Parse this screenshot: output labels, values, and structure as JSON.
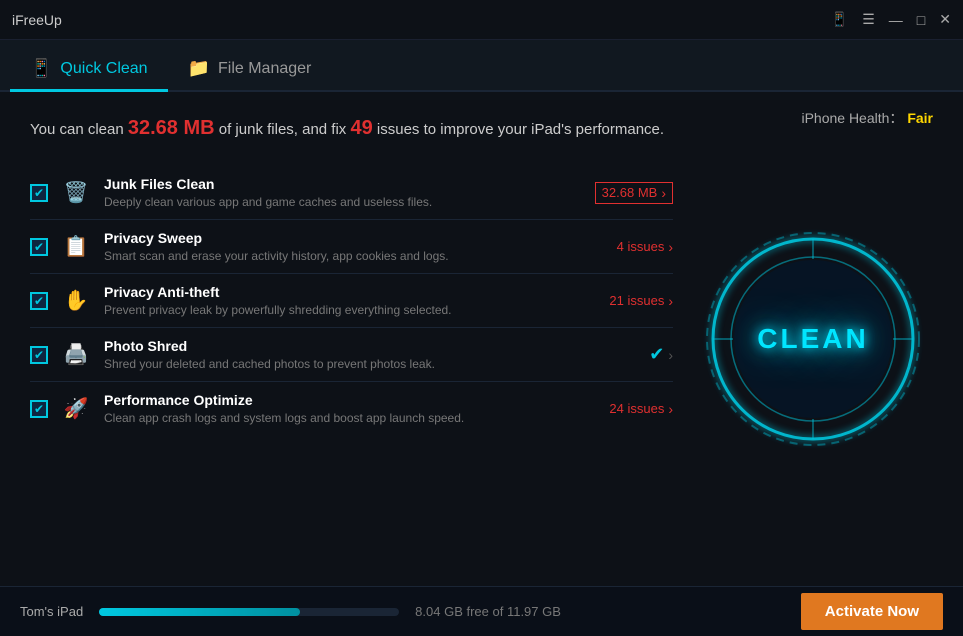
{
  "app": {
    "title": "iFreeUp"
  },
  "window_controls": {
    "device_icon": "📱",
    "menu_icon": "☰",
    "minimize": "—",
    "maximize": "□",
    "close": "✕"
  },
  "tabs": [
    {
      "id": "quick-clean",
      "label": "Quick Clean",
      "icon": "📱",
      "active": true
    },
    {
      "id": "file-manager",
      "label": "File Manager",
      "icon": "📁",
      "active": false
    }
  ],
  "header": {
    "intro_before": "You can clean ",
    "junk_size": "32.68 MB",
    "intro_mid": " of junk files, and fix ",
    "issues_count": "49",
    "intro_after": " issues to improve your iPad's performance.",
    "iphone_health_label": "iPhone Health：",
    "iphone_health_value": "Fair"
  },
  "clean_button": {
    "label": "CLEAN"
  },
  "items": [
    {
      "id": "junk-files",
      "title": "Junk Files Clean",
      "description": "Deeply clean various app and game caches and useless files.",
      "badge": "32.68 MB",
      "badge_type": "boxed",
      "icon": "🗑️",
      "checked": true
    },
    {
      "id": "privacy-sweep",
      "title": "Privacy Sweep",
      "description": "Smart scan and erase your activity history, app cookies and logs.",
      "badge": "4 issues",
      "badge_type": "normal",
      "icon": "📋",
      "checked": true
    },
    {
      "id": "privacy-anti-theft",
      "title": "Privacy Anti-theft",
      "description": "Prevent privacy leak by powerfully shredding everything selected.",
      "badge": "21 issues",
      "badge_type": "normal",
      "icon": "✋",
      "checked": true
    },
    {
      "id": "photo-shred",
      "title": "Photo Shred",
      "description": "Shred your deleted and cached photos to prevent photos leak.",
      "badge": "✔",
      "badge_type": "ok",
      "icon": "🖨️",
      "checked": true
    },
    {
      "id": "performance-optimize",
      "title": "Performance Optimize",
      "description": "Clean app crash logs and system logs and boost app launch speed.",
      "badge": "24 issues",
      "badge_type": "normal",
      "icon": "🚀",
      "checked": true
    }
  ],
  "bottom_bar": {
    "device_name": "Tom's iPad",
    "storage_used_pct": 67,
    "storage_text": "8.04 GB free of 11.97 GB",
    "activate_label": "Activate Now"
  }
}
